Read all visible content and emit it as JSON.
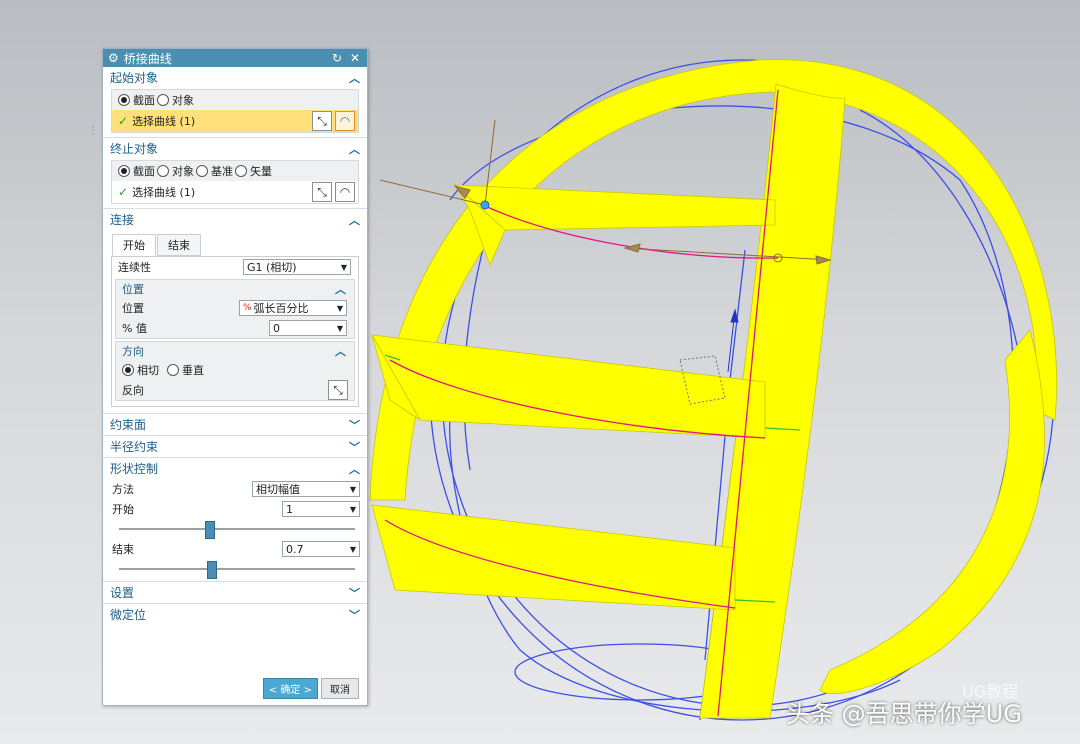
{
  "dialog": {
    "title": "桥接曲线",
    "start_section": {
      "title": "起始对象",
      "options": [
        "截面",
        "对象"
      ],
      "selected": "截面",
      "select_label": "选择曲线 (1)"
    },
    "end_section": {
      "title": "终止对象",
      "options": [
        "截面",
        "对象",
        "基准",
        "矢量"
      ],
      "selected": "截面",
      "select_label": "选择曲线 (1)"
    },
    "connect_section": {
      "title": "连接",
      "tabs": [
        "开始",
        "结束"
      ],
      "continuity_label": "连续性",
      "continuity_value": "G1 (相切)",
      "position_group": {
        "title": "位置",
        "position_label": "位置",
        "position_value": "弧长百分比",
        "percent_label": "% 值",
        "percent_value": "0"
      },
      "direction_group": {
        "title": "方向",
        "options": [
          "相切",
          "垂直"
        ],
        "selected": "相切",
        "reverse_label": "反向"
      }
    },
    "constraint_face": "约束面",
    "radius_constraint": "半径约束",
    "shape_control": {
      "title": "形状控制",
      "method_label": "方法",
      "method_value": "相切幅值",
      "start_label": "开始",
      "start_value": "1",
      "start_slider": 0.38,
      "end_label": "结束",
      "end_value": "0.7",
      "end_slider": 0.39
    },
    "settings": "设置",
    "fine_position": "微定位",
    "ok_label": "< 确定 >",
    "cancel_label": "取消"
  },
  "watermark": "头条 @吾思带你学UG",
  "watermark_small": "UG教程",
  "colors": {
    "yellow": "#ffff00",
    "wire": "#2f3cff",
    "magenta": "#e0157d",
    "titlebar": "#4a8fb2"
  }
}
